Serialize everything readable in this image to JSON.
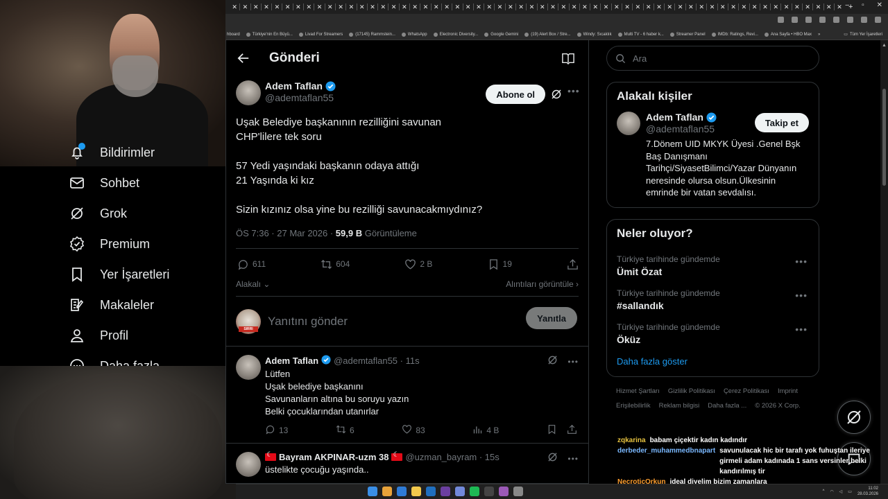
{
  "browser": {
    "tab_count": 58,
    "bookmarks": [
      "hboard",
      "Türkiye'nin En Büyü...",
      "Livad For Streamers",
      "(17145) Rammstein...",
      "WhatsApp",
      "Electronic Diversity...",
      "Google Gemini",
      "(19) Alert Box / Stre...",
      "Windy: Sıcaklık",
      "Multi TV - 6 haber k...",
      "Streamer Panel",
      "IMDb: Ratings, Revi...",
      "Ana Sayfa • HBO Max"
    ],
    "bookmarks_overflow": "»",
    "all_bookmarks": "Tüm Yer İşaretleri"
  },
  "nav": {
    "items": [
      {
        "label": "Bildirimler",
        "icon": "bell-icon"
      },
      {
        "label": "Sohbet",
        "icon": "mail-icon"
      },
      {
        "label": "Grok",
        "icon": "grok-icon"
      },
      {
        "label": "Premium",
        "icon": "premium-icon"
      },
      {
        "label": "Yer İşaretleri",
        "icon": "bookmark-icon"
      },
      {
        "label": "Makaleler",
        "icon": "article-icon"
      },
      {
        "label": "Profil",
        "icon": "person-icon"
      },
      {
        "label": "Daha fazla",
        "icon": "more-circle-icon"
      }
    ]
  },
  "header": {
    "title": "Gönderi"
  },
  "post": {
    "author_name": "Adem Taflan",
    "handle": "@ademtaflan55",
    "follow_label": "Abone ol",
    "text": "Uşak Belediye başkanının rezilliğini savunan\nCHP'lilere tek soru\n\n57 Yedi yaşındaki başkanın odaya attığı\n21 Yaşında ki kız\n\nSizin kızınız olsa yine bu rezilliği savunacakmıydınız?",
    "timestamp": "ÖS 7:36 · 27 Mar 2026 · ",
    "views_value": "59,9 B",
    "views_label": " Görüntüleme",
    "replies": "611",
    "reposts": "604",
    "likes": "2 B",
    "bookmarks": "19",
    "related_label": "Alakalı",
    "quotes_label": "Alıntıları görüntüle"
  },
  "composer": {
    "placeholder": "Yanıtını gönder",
    "reply_label": "Yanıtla",
    "avatar_stamp": "SIRRI"
  },
  "replies": [
    {
      "name": "Adem Taflan",
      "handle": "@ademtaflan55 · 11s",
      "text": "Lütfen\nUşak belediye başkanını\nSavunanların altına bu soruyu yazın\nBelki çocuklarından utanırlar",
      "replies": "13",
      "reposts": "6",
      "likes": "83",
      "views": "4 B"
    },
    {
      "name": "Bayram AKPINAR-uzm 38",
      "handle": "@uzman_bayram · 15s",
      "text": "üstelikte çocuğu yaşında.."
    }
  ],
  "sidebar": {
    "search_placeholder": "Ara",
    "related_title": "Alakalı kişiler",
    "related_person": {
      "name": "Adem Taflan",
      "handle": "@ademtaflan55",
      "follow_label": "Takip et",
      "bio": "7.Dönem UID MKYK Üyesi .Genel Bşk Baş Danışmanı Tarihçi/SiyasetBilimci/Yazar Dünyanın neresinde olursa olsun.Ülkesinin emrinde bir vatan sevdalısı."
    },
    "trends_title": "Neler oluyor?",
    "trends": [
      {
        "context": "Türkiye tarihinde gündemde",
        "name": "Ümit Özat"
      },
      {
        "context": "Türkiye tarihinde gündemde",
        "name": "#sallandık"
      },
      {
        "context": "Türkiye tarihinde gündemde",
        "name": "Öküz"
      }
    ],
    "show_more": "Daha fazla göster",
    "footer_links": [
      "Hizmet Şartları",
      "Gizlilik Politikası",
      "Çerez Politikası",
      "Imprint",
      "Erişilebilirlik",
      "Reklam bilgisi",
      "Daha fazla ...",
      "© 2026 X Corp."
    ]
  },
  "chat": [
    {
      "user": "zqkarina",
      "color": "#e8c440",
      "message": "babam çiçektir kadın kadındır"
    },
    {
      "user": "derbeder_muhammedbnapart",
      "color": "#7ab8ff",
      "message": "savunulacak hic bir tarafı yok fuhuştan ileriye girmeli adam kadınada 1 sans versinler belki kandırılmış tir"
    },
    {
      "user": "NecroticOrkun",
      "color": "#ff9f2f",
      "message": "ideal diyelim bizim zamanlara"
    }
  ],
  "taskbar": {
    "time": "11:02",
    "date": "28.03.2026"
  },
  "colors": {
    "accent": "#1d9bf0",
    "background": "#000000",
    "muted": "#71767b",
    "border": "#2f3336"
  }
}
